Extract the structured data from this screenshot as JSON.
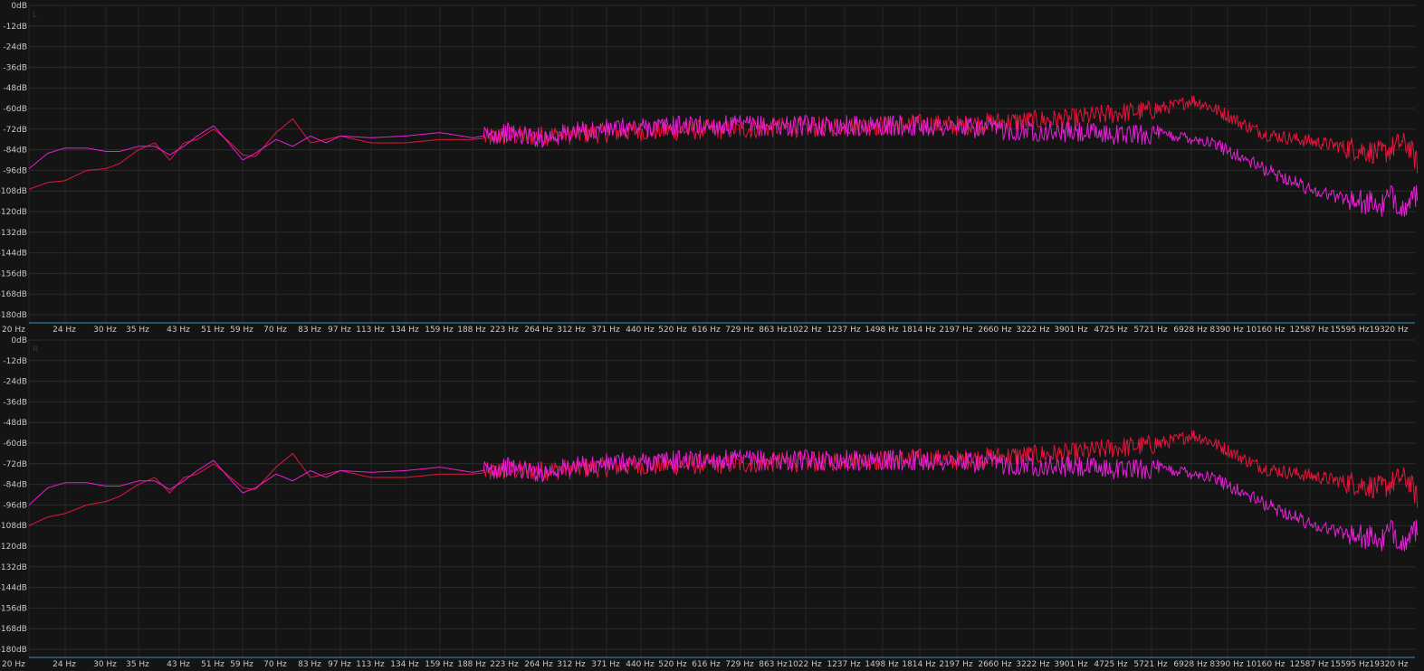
{
  "chart_data": [
    {
      "type": "line",
      "title": "L",
      "x_scale": "log",
      "xlim": [
        20,
        23000
      ],
      "ylim": [
        -180,
        0
      ],
      "y_ticks": [
        "0dB",
        "-12dB",
        "-24dB",
        "-36dB",
        "-48dB",
        "-60dB",
        "-72dB",
        "-84dB",
        "-96dB",
        "-108dB",
        "-120dB",
        "-132dB",
        "-144dB",
        "-156dB",
        "-168dB",
        "-180dB"
      ],
      "x_ticks": [
        "20 Hz",
        "24 Hz",
        "30 Hz",
        "35 Hz",
        "43 Hz",
        "51 Hz",
        "59 Hz",
        "70 Hz",
        "83 Hz",
        "97 Hz",
        "113 Hz",
        "134 Hz",
        "159 Hz",
        "188 Hz",
        "223 Hz",
        "264 Hz",
        "312 Hz",
        "371 Hz",
        "440 Hz",
        "520 Hz",
        "616 Hz",
        "729 Hz",
        "863 Hz",
        "1022 Hz",
        "1237 Hz",
        "1498 Hz",
        "1814 Hz",
        "2197 Hz",
        "2660 Hz",
        "3222 Hz",
        "3901 Hz",
        "4725 Hz",
        "5721 Hz",
        "6928 Hz",
        "8390 Hz",
        "10160 Hz",
        "12587 Hz",
        "15595 Hz",
        "19320 Hz"
      ],
      "grid": true,
      "series": [
        {
          "color": "#e8143c",
          "x": [
            20,
            22,
            24,
            27,
            30,
            32,
            35,
            38,
            41,
            44,
            47,
            51,
            55,
            59,
            63,
            70,
            76,
            83,
            90,
            97,
            113,
            134,
            159,
            188,
            223,
            264,
            312,
            371,
            440,
            520,
            616,
            729,
            863,
            1022,
            1237,
            1498,
            1814,
            2197,
            2660,
            3222,
            3901,
            4725,
            5721,
            6500,
            6928,
            7500,
            8390,
            9200,
            10160,
            11300,
            12587,
            14000,
            15595,
            17300,
            18500,
            19320,
            20500,
            21500,
            22500
          ],
          "values": [
            -107,
            -103,
            -102,
            -96,
            -95,
            -92,
            -84,
            -80,
            -90,
            -80,
            -78,
            -72,
            -79,
            -87,
            -88,
            -74,
            -66,
            -80,
            -78,
            -76,
            -80,
            -80,
            -78,
            -78,
            -76,
            -76,
            -75,
            -74,
            -73,
            -73,
            -72,
            -72,
            -71,
            -71,
            -70,
            -70,
            -69,
            -70,
            -68,
            -67,
            -66,
            -63,
            -61,
            -58,
            -55,
            -58,
            -64,
            -70,
            -75,
            -77,
            -79,
            -81,
            -83,
            -85,
            -86,
            -84,
            -80,
            -82,
            -92
          ]
        },
        {
          "color": "#e81ed8",
          "x": [
            20,
            22,
            24,
            27,
            30,
            32,
            35,
            38,
            41,
            44,
            47,
            51,
            55,
            59,
            63,
            70,
            76,
            83,
            90,
            97,
            113,
            134,
            159,
            188,
            223,
            264,
            312,
            371,
            440,
            520,
            616,
            729,
            863,
            1022,
            1237,
            1498,
            1814,
            2197,
            2660,
            3222,
            3901,
            4725,
            5721,
            6500,
            6928,
            7500,
            8390,
            9200,
            10160,
            11300,
            12587,
            14000,
            15595,
            17300,
            18500,
            19320,
            20500,
            21500,
            22500
          ],
          "values": [
            -95,
            -86,
            -83,
            -83,
            -85,
            -85,
            -82,
            -82,
            -87,
            -82,
            -76,
            -70,
            -80,
            -90,
            -86,
            -78,
            -82,
            -76,
            -80,
            -76,
            -77,
            -76,
            -74,
            -77,
            -74,
            -77,
            -74,
            -72,
            -71,
            -70,
            -70,
            -70,
            -70,
            -70,
            -70,
            -70,
            -70,
            -71,
            -72,
            -73,
            -74,
            -75,
            -75,
            -76,
            -77,
            -79,
            -84,
            -90,
            -96,
            -101,
            -107,
            -110,
            -113,
            -115,
            -117,
            -111,
            -116,
            -118,
            -108
          ]
        }
      ]
    },
    {
      "type": "line",
      "title": "R",
      "x_scale": "log",
      "xlim": [
        20,
        23000
      ],
      "ylim": [
        -180,
        0
      ],
      "y_ticks": [
        "0dB",
        "-12dB",
        "-24dB",
        "-36dB",
        "-48dB",
        "-60dB",
        "-72dB",
        "-84dB",
        "-96dB",
        "-108dB",
        "-120dB",
        "-132dB",
        "-144dB",
        "-156dB",
        "-168dB",
        "-180dB"
      ],
      "x_ticks": [
        "20 Hz",
        "24 Hz",
        "30 Hz",
        "35 Hz",
        "43 Hz",
        "51 Hz",
        "59 Hz",
        "70 Hz",
        "83 Hz",
        "97 Hz",
        "113 Hz",
        "134 Hz",
        "159 Hz",
        "188 Hz",
        "223 Hz",
        "264 Hz",
        "312 Hz",
        "371 Hz",
        "440 Hz",
        "520 Hz",
        "616 Hz",
        "729 Hz",
        "863 Hz",
        "1022 Hz",
        "1237 Hz",
        "1498 Hz",
        "1814 Hz",
        "2197 Hz",
        "2660 Hz",
        "3222 Hz",
        "3901 Hz",
        "4725 Hz",
        "5721 Hz",
        "6928 Hz",
        "8390 Hz",
        "10160 Hz",
        "12587 Hz",
        "15595 Hz",
        "19320 Hz"
      ],
      "grid": true,
      "series": [
        {
          "color": "#e8143c",
          "x": [
            20,
            22,
            24,
            27,
            30,
            32,
            35,
            38,
            41,
            44,
            47,
            51,
            55,
            59,
            63,
            70,
            76,
            83,
            90,
            97,
            113,
            134,
            159,
            188,
            223,
            264,
            312,
            371,
            440,
            520,
            616,
            729,
            863,
            1022,
            1237,
            1498,
            1814,
            2197,
            2660,
            3222,
            3901,
            4725,
            5721,
            6500,
            6928,
            7500,
            8390,
            9200,
            10160,
            11300,
            12587,
            14000,
            15595,
            17300,
            18500,
            19320,
            20500,
            21500,
            22500
          ],
          "values": [
            -108,
            -103,
            -101,
            -96,
            -94,
            -91,
            -84,
            -80,
            -89,
            -80,
            -78,
            -72,
            -79,
            -86,
            -87,
            -74,
            -66,
            -80,
            -78,
            -76,
            -80,
            -80,
            -78,
            -78,
            -76,
            -76,
            -75,
            -74,
            -73,
            -73,
            -72,
            -72,
            -71,
            -71,
            -70,
            -70,
            -69,
            -70,
            -68,
            -67,
            -66,
            -63,
            -61,
            -58,
            -55,
            -58,
            -64,
            -70,
            -75,
            -77,
            -79,
            -81,
            -83,
            -85,
            -86,
            -84,
            -80,
            -82,
            -92
          ]
        },
        {
          "color": "#e81ed8",
          "x": [
            20,
            22,
            24,
            27,
            30,
            32,
            35,
            38,
            41,
            44,
            47,
            51,
            55,
            59,
            63,
            70,
            76,
            83,
            90,
            97,
            113,
            134,
            159,
            188,
            223,
            264,
            312,
            371,
            440,
            520,
            616,
            729,
            863,
            1022,
            1237,
            1498,
            1814,
            2197,
            2660,
            3222,
            3901,
            4725,
            5721,
            6500,
            6928,
            7500,
            8390,
            9200,
            10160,
            11300,
            12587,
            14000,
            15595,
            17300,
            18500,
            19320,
            20500,
            21500,
            22500
          ],
          "values": [
            -96,
            -86,
            -83,
            -83,
            -85,
            -85,
            -82,
            -82,
            -87,
            -82,
            -76,
            -70,
            -80,
            -89,
            -86,
            -78,
            -82,
            -76,
            -80,
            -76,
            -77,
            -76,
            -74,
            -77,
            -74,
            -77,
            -74,
            -72,
            -71,
            -70,
            -70,
            -70,
            -70,
            -70,
            -70,
            -70,
            -70,
            -71,
            -72,
            -73,
            -74,
            -75,
            -75,
            -76,
            -77,
            -79,
            -84,
            -90,
            -96,
            -101,
            -107,
            -110,
            -113,
            -115,
            -117,
            -111,
            -116,
            -118,
            -108
          ]
        }
      ]
    }
  ]
}
